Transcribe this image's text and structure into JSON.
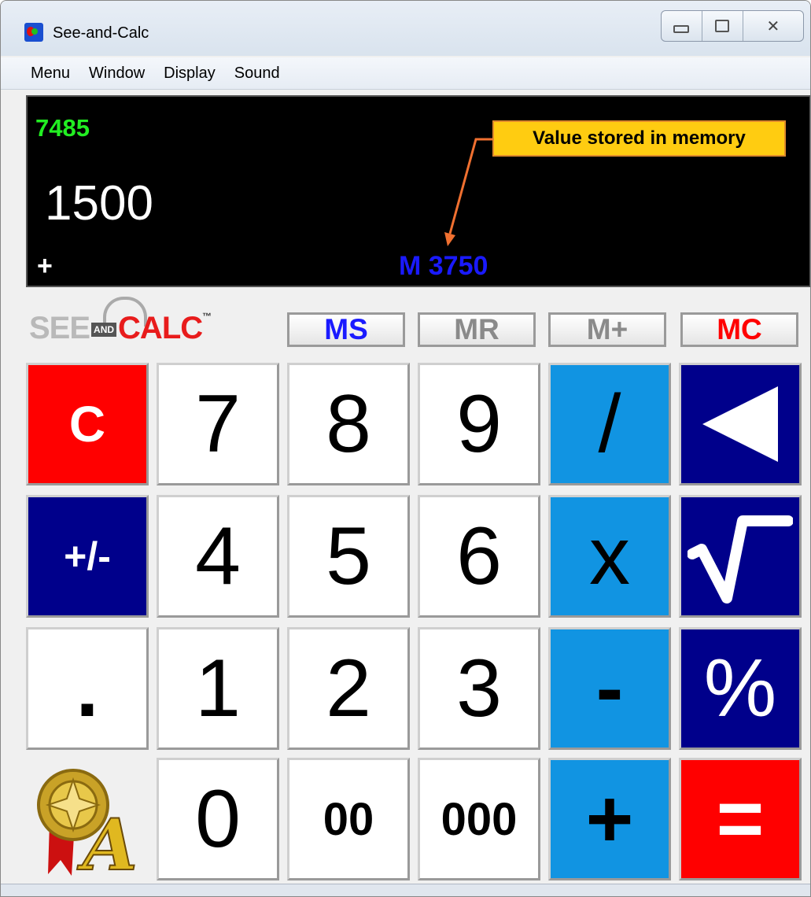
{
  "window": {
    "title": "See-and-Calc",
    "controls": {
      "minimize": "▭",
      "maximize": "▢",
      "close": "✕"
    }
  },
  "menu": {
    "items": [
      "Menu",
      "Window",
      "Display",
      "Sound"
    ]
  },
  "display": {
    "history": "7485",
    "main": "1500",
    "operator": "+",
    "memory": "M 3750"
  },
  "callout": {
    "text": "Value stored in memory"
  },
  "logo": {
    "see": "SEE",
    "and": "AND",
    "calc": "CALC",
    "tm": "™"
  },
  "memory_buttons": [
    {
      "label": "MS",
      "color": "#1a1aff"
    },
    {
      "label": "MR",
      "color": "#8a8a8a"
    },
    {
      "label": "M+",
      "color": "#8a8a8a"
    },
    {
      "label": "MC",
      "color": "#ff0000"
    }
  ],
  "keys": {
    "clear": "C",
    "seven": "7",
    "eight": "8",
    "nine": "9",
    "divide": "/",
    "backspace": "◀",
    "plusminus": "+/-",
    "four": "4",
    "five": "5",
    "six": "6",
    "multiply": "x",
    "sqrt": "√",
    "dot": ".",
    "one": "1",
    "two": "2",
    "three": "3",
    "minus": "-",
    "percent": "%",
    "zero": "0",
    "double_zero": "00",
    "triple_zero": "000",
    "plus": "+",
    "equals": "="
  },
  "colors": {
    "display_bg": "#000000",
    "history": "#22ee22",
    "memory": "#1a1aff",
    "operator_keys": "#1194e2",
    "function_keys": "#00008b",
    "clear_equals": "#ff0000",
    "callout_bg": "#ffcc11"
  }
}
